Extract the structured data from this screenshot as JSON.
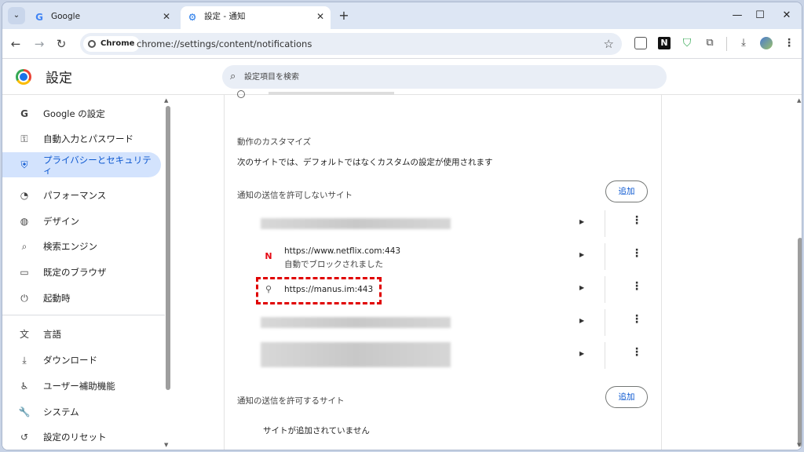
{
  "tabs": [
    {
      "title": "Google",
      "icon": "google-icon"
    },
    {
      "title": "設定 - 通知",
      "icon": "gear-icon"
    }
  ],
  "toolbar": {
    "chip_label": "Chrome",
    "url": "chrome://settings/content/notifications"
  },
  "header": {
    "title": "設定",
    "search_placeholder": "設定項目を検索"
  },
  "sidebar": {
    "items": [
      {
        "label": "Google の設定",
        "icon": "google-g-icon"
      },
      {
        "label": "自動入力とパスワード",
        "icon": "key-icon"
      },
      {
        "label": "プライバシーとセキュリティ",
        "icon": "shield-icon"
      },
      {
        "label": "パフォーマンス",
        "icon": "gauge-icon"
      },
      {
        "label": "デザイン",
        "icon": "palette-icon"
      },
      {
        "label": "検索エンジン",
        "icon": "search-icon"
      },
      {
        "label": "既定のブラウザ",
        "icon": "browser-icon"
      },
      {
        "label": "起動時",
        "icon": "power-icon"
      },
      {
        "label": "言語",
        "icon": "translate-icon"
      },
      {
        "label": "ダウンロード",
        "icon": "download-icon"
      },
      {
        "label": "ユーザー補助機能",
        "icon": "accessibility-icon"
      },
      {
        "label": "システム",
        "icon": "wrench-icon"
      },
      {
        "label": "設定のリセット",
        "icon": "reset-icon"
      }
    ]
  },
  "main": {
    "custom_heading": "動作のカスタマイズ",
    "custom_desc": "次のサイトでは、デフォルトではなくカスタムの設定が使用されます",
    "blocked_heading": "通知の送信を許可しないサイト",
    "add_label": "追加",
    "blocked_sites": [
      {
        "name": "",
        "sub": "",
        "blurred": true
      },
      {
        "name": "https://www.netflix.com:443",
        "sub": "自動でブロックされました",
        "icon": "netflix-icon",
        "blurred": false
      },
      {
        "name": "https://manus.im:443",
        "sub": "",
        "icon": "clip-icon",
        "blurred": false
      },
      {
        "name": "",
        "sub": "",
        "blurred": true
      },
      {
        "name": "",
        "sub": "",
        "blurred": true
      }
    ],
    "allowed_heading": "通知の送信を許可するサイト",
    "allowed_empty": "サイトが追加されていません"
  },
  "colors": {
    "accent": "#0b57d0",
    "active_nav_bg": "#d3e3fd",
    "highlight": "#e00000"
  }
}
